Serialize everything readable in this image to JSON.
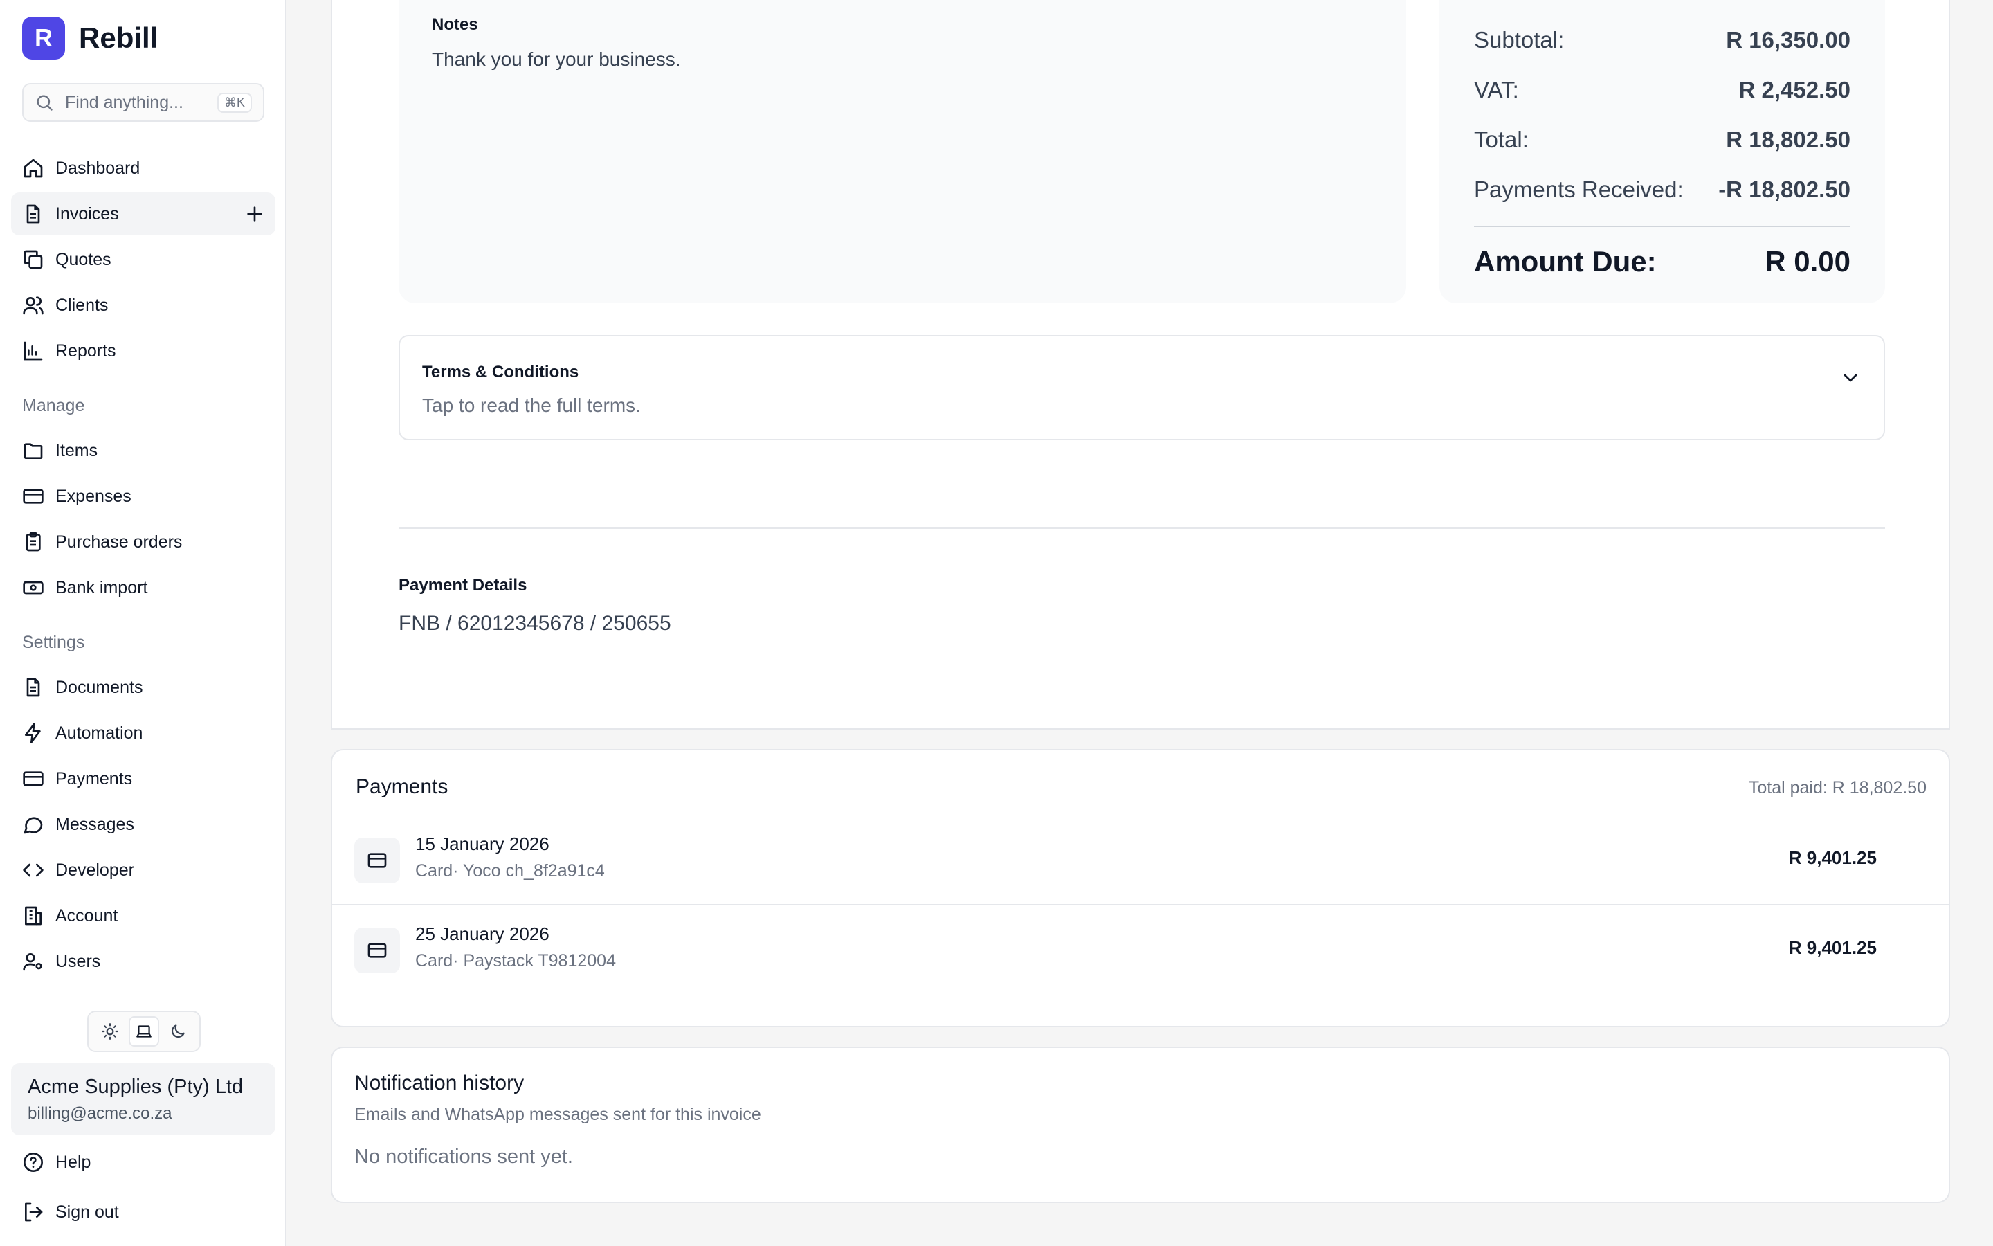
{
  "app": {
    "name": "Rebill",
    "logo_letter": "R",
    "accent_color": "#4f46e5"
  },
  "search": {
    "placeholder": "Find anything...",
    "shortcut": "⌘K"
  },
  "sidebar": {
    "main_items": [
      {
        "label": "Dashboard",
        "icon": "home-icon"
      },
      {
        "label": "Invoices",
        "icon": "file-icon",
        "active": true
      },
      {
        "label": "Quotes",
        "icon": "copy-icon"
      },
      {
        "label": "Clients",
        "icon": "users-icon"
      },
      {
        "label": "Reports",
        "icon": "bar-chart-icon"
      }
    ],
    "manage_label": "Manage",
    "manage_items": [
      {
        "label": "Items",
        "icon": "folder-icon"
      },
      {
        "label": "Expenses",
        "icon": "credit-card-icon"
      },
      {
        "label": "Purchase orders",
        "icon": "clipboard-icon"
      },
      {
        "label": "Bank import",
        "icon": "banknote-icon"
      }
    ],
    "settings_label": "Settings",
    "settings_items": [
      {
        "label": "Documents",
        "icon": "file-text-icon"
      },
      {
        "label": "Automation",
        "icon": "zap-icon"
      },
      {
        "label": "Payments",
        "icon": "credit-card-icon"
      },
      {
        "label": "Messages",
        "icon": "message-circle-icon"
      },
      {
        "label": "Developer",
        "icon": "code-icon"
      },
      {
        "label": "Account",
        "icon": "building-icon"
      },
      {
        "label": "Users",
        "icon": "user-cog-icon"
      }
    ],
    "theme": {
      "options": [
        "light",
        "system",
        "dark"
      ],
      "selected": "system"
    },
    "account": {
      "name": "Acme Supplies (Pty) Ltd",
      "email": "billing@acme.co.za"
    },
    "help_label": "Help",
    "signout_label": "Sign out"
  },
  "invoice": {
    "notes": {
      "heading": "Notes",
      "text": "Thank you for your business."
    },
    "totals": {
      "subtotal_label": "Subtotal:",
      "subtotal": "R 16,350.00",
      "vat_label": "VAT:",
      "vat": "R 2,452.50",
      "total_label": "Total:",
      "total": "R 18,802.50",
      "received_label": "Payments Received:",
      "received": "-R 18,802.50",
      "due_label": "Amount Due:",
      "due": "R 0.00"
    },
    "terms": {
      "heading": "Terms & Conditions",
      "subtext": "Tap to read the full terms."
    },
    "payment_details": {
      "heading": "Payment Details",
      "text": "FNB / 62012345678 / 250655"
    }
  },
  "payments": {
    "title": "Payments",
    "total_paid": "Total paid: R 18,802.50",
    "rows": [
      {
        "date": "15 January 2026",
        "description": "Card· Yoco ch_8f2a91c4",
        "amount": "R 9,401.25"
      },
      {
        "date": "25 January 2026",
        "description": "Card· Paystack T9812004",
        "amount": "R 9,401.25"
      }
    ]
  },
  "notifications": {
    "title": "Notification history",
    "subtitle": "Emails and WhatsApp messages sent for this invoice",
    "empty": "No notifications sent yet."
  }
}
